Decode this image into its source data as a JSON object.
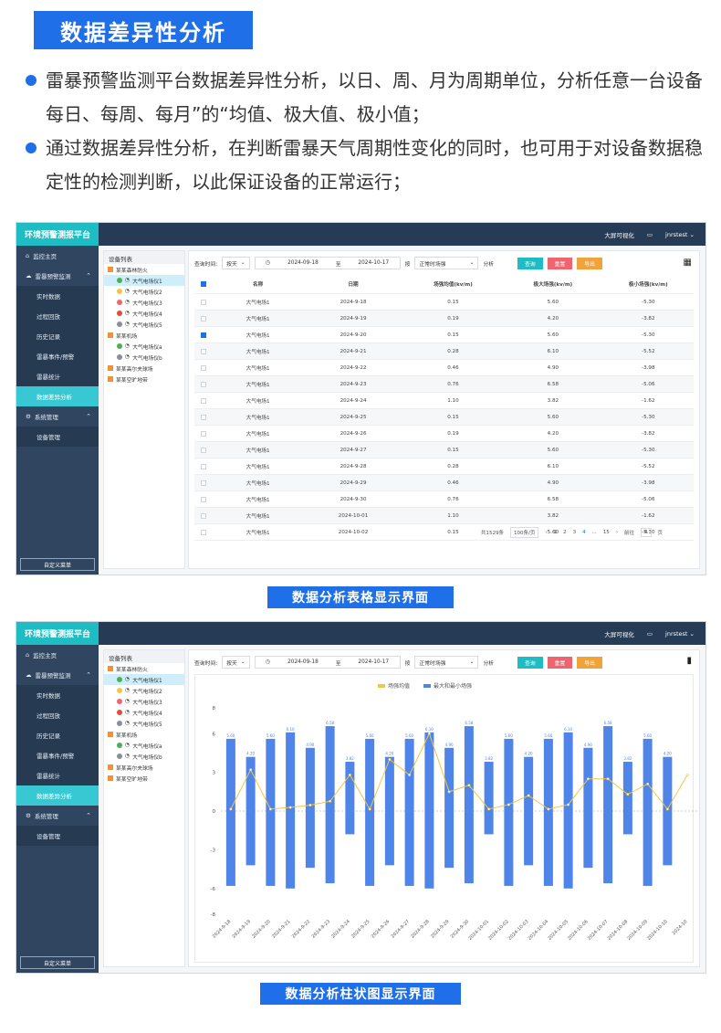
{
  "heading": "数据差异性分析",
  "bullets": [
    "雷暴预警监测平台数据差异性分析，以日、周、月为周期单位，分析任意一台设备每日、每周、每月”的“均值、极大值、极小值；",
    "通过数据差异性分析，在判断雷暴天气周期性变化的同时，也可用于对设备数据稳定性的检测判断，以此保证设备的正常运行；"
  ],
  "app": {
    "brand": "环境预警测报平台",
    "bigscreen": "大屏可视化",
    "user": "jnrstest",
    "custom_menu": "自定义菜单",
    "menu": [
      {
        "label": "监控主页",
        "type": "top",
        "icon": "home-icon",
        "glyph": "⌂"
      },
      {
        "label": "雷暴预警监测",
        "type": "top",
        "icon": "cloud-icon",
        "glyph": "☁",
        "chev": "⌃"
      },
      {
        "label": "实时数据",
        "type": "sub"
      },
      {
        "label": "过程回放",
        "type": "sub"
      },
      {
        "label": "历史记录",
        "type": "sub"
      },
      {
        "label": "雷暴事件/预警",
        "type": "sub"
      },
      {
        "label": "雷暴统计",
        "type": "sub"
      },
      {
        "label": "数据差异分析",
        "type": "sub",
        "active": true
      },
      {
        "label": "系统管理",
        "type": "top",
        "icon": "gear-icon",
        "glyph": "⚙",
        "chev": "⌃"
      },
      {
        "label": "设备管理",
        "type": "sub"
      }
    ],
    "device_list_title": "设备列表",
    "devices": [
      {
        "label": "某某森林防火",
        "grp": true
      },
      {
        "label": "大气电场仪1",
        "color": "#4caf50",
        "sel": true
      },
      {
        "label": "大气电场仪2",
        "color": "#f5c542"
      },
      {
        "label": "大气电场仪3",
        "color": "#f06470"
      },
      {
        "label": "大气电场仪4",
        "color": "#e84a3a"
      },
      {
        "label": "大气电场仪5",
        "color": "#8a8f96"
      },
      {
        "label": "某某机场",
        "grp": true
      },
      {
        "label": "大气电场仪a",
        "color": "#4caf50"
      },
      {
        "label": "大气电场仪b",
        "color": "#8a8f96"
      },
      {
        "label": "某某高尔夫球场",
        "grp": true
      },
      {
        "label": "某某空旷地带",
        "grp": true
      }
    ],
    "filter": {
      "query_time": "查询时间:",
      "period": "按天",
      "from": "2024-09-18",
      "to_label": "至",
      "to": "2024-10-17",
      "by_label": "按",
      "metric": "正常时场强",
      "analyze": "分析",
      "query": "查询",
      "reset": "重置",
      "export": "导出"
    }
  },
  "table": {
    "headers": [
      "名称",
      "日期",
      "场强均值(kv/m)",
      "极大场强(kv/m)",
      "极小场强(kv/m)"
    ],
    "rows": [
      [
        "大气电场1",
        "2024-9-18",
        "0.15",
        "5.60",
        "-5.30"
      ],
      [
        "大气电场1",
        "2024-9-19",
        "0.19",
        "4.20",
        "-3.82"
      ],
      [
        "大气电场1",
        "2024-9-20",
        "0.15",
        "5.60",
        "-5.30"
      ],
      [
        "大气电场1",
        "2024-9-21",
        "0.28",
        "6.10",
        "-5.52"
      ],
      [
        "大气电场1",
        "2024-9-22",
        "0.46",
        "4.90",
        "-3.98"
      ],
      [
        "大气电场1",
        "2024-9-23",
        "0.76",
        "6.58",
        "-5.06"
      ],
      [
        "大气电场1",
        "2024-9-24",
        "1.10",
        "3.82",
        "-1.62"
      ],
      [
        "大气电场1",
        "2024-9-25",
        "0.15",
        "5.60",
        "-5.30"
      ],
      [
        "大气电场1",
        "2024-9-26",
        "0.19",
        "4.20",
        "-3.82"
      ],
      [
        "大气电场1",
        "2024-9-27",
        "0.15",
        "5.60",
        "-5.30"
      ],
      [
        "大气电场1",
        "2024-9-28",
        "0.28",
        "6.10",
        "-5.52"
      ],
      [
        "大气电场1",
        "2024-9-29",
        "0.46",
        "4.90",
        "-3.98"
      ],
      [
        "大气电场1",
        "2024-9-30",
        "0.76",
        "6.58",
        "-5.06"
      ],
      [
        "大气电场1",
        "2024-10-01",
        "1.10",
        "3.82",
        "-1.62"
      ],
      [
        "大气电场1",
        "2024-10-02",
        "0.15",
        "5.60",
        "-5.30"
      ]
    ],
    "checked": [
      2
    ],
    "pager": {
      "total": "共1529条",
      "size": "100条/页",
      "pages": [
        "1",
        "2",
        "3",
        "4",
        "...",
        "15"
      ],
      "current": "4",
      "goto": "前往",
      "goto_val": "4",
      "page_unit": "页"
    }
  },
  "caption1": "数据分析表格显示界面",
  "caption2": "数据分析柱状图显示界面",
  "chart_data": {
    "type": "bar",
    "legend": [
      "场强均值",
      "最大和最小场强"
    ],
    "legend_position": "top-center",
    "categories": [
      "2024-9-18",
      "2024-9-19",
      "2024-9-20",
      "2024-9-21",
      "2024-9-22",
      "2024-9-23",
      "2024-9-24",
      "2024-9-25",
      "2024-9-26",
      "2024-9-27",
      "2024-9-28",
      "2024-9-29",
      "2024-9-30",
      "2024-10-01",
      "2024-10-02",
      "2024-10-03",
      "2024-10-04",
      "2024-10-05",
      "2024-10-06",
      "2024-10-07",
      "2024-10-08",
      "2024-10-09",
      "2024-10-10",
      "2024-10"
    ],
    "max": [
      5.6,
      4.2,
      5.6,
      6.1,
      4.9,
      6.58,
      3.82,
      5.6,
      4.2,
      5.6,
      6.1,
      4.9,
      6.58,
      3.82,
      5.6,
      4.2,
      5.6,
      6.1,
      4.9,
      6.58,
      3.82,
      5.6,
      4.2
    ],
    "min": [
      -5.8,
      -4.2,
      -5.8,
      -6.0,
      -4.4,
      -5.6,
      -1.8,
      -5.8,
      -4.2,
      -5.8,
      -6.0,
      -4.4,
      -5.6,
      -1.8,
      -5.8,
      -4.2,
      -5.8,
      -6.0,
      -4.4,
      -5.6,
      -1.8,
      -5.8,
      -4.2
    ],
    "mean": [
      0.15,
      3.2,
      0.15,
      0.28,
      0.46,
      0.76,
      2.8,
      0.15,
      4.0,
      2.8,
      6.0,
      1.5,
      2.0,
      0.15,
      0.5,
      1.2,
      0.15,
      0.5,
      2.5,
      2.5,
      1.3,
      2.1,
      0.15,
      2.8
    ],
    "ylim": [
      -8,
      8
    ],
    "yticks": [
      -8,
      -6,
      -3,
      0,
      3,
      6,
      8
    ],
    "colors": {
      "bar": "#4f84e8",
      "line": "#f5c542"
    }
  }
}
